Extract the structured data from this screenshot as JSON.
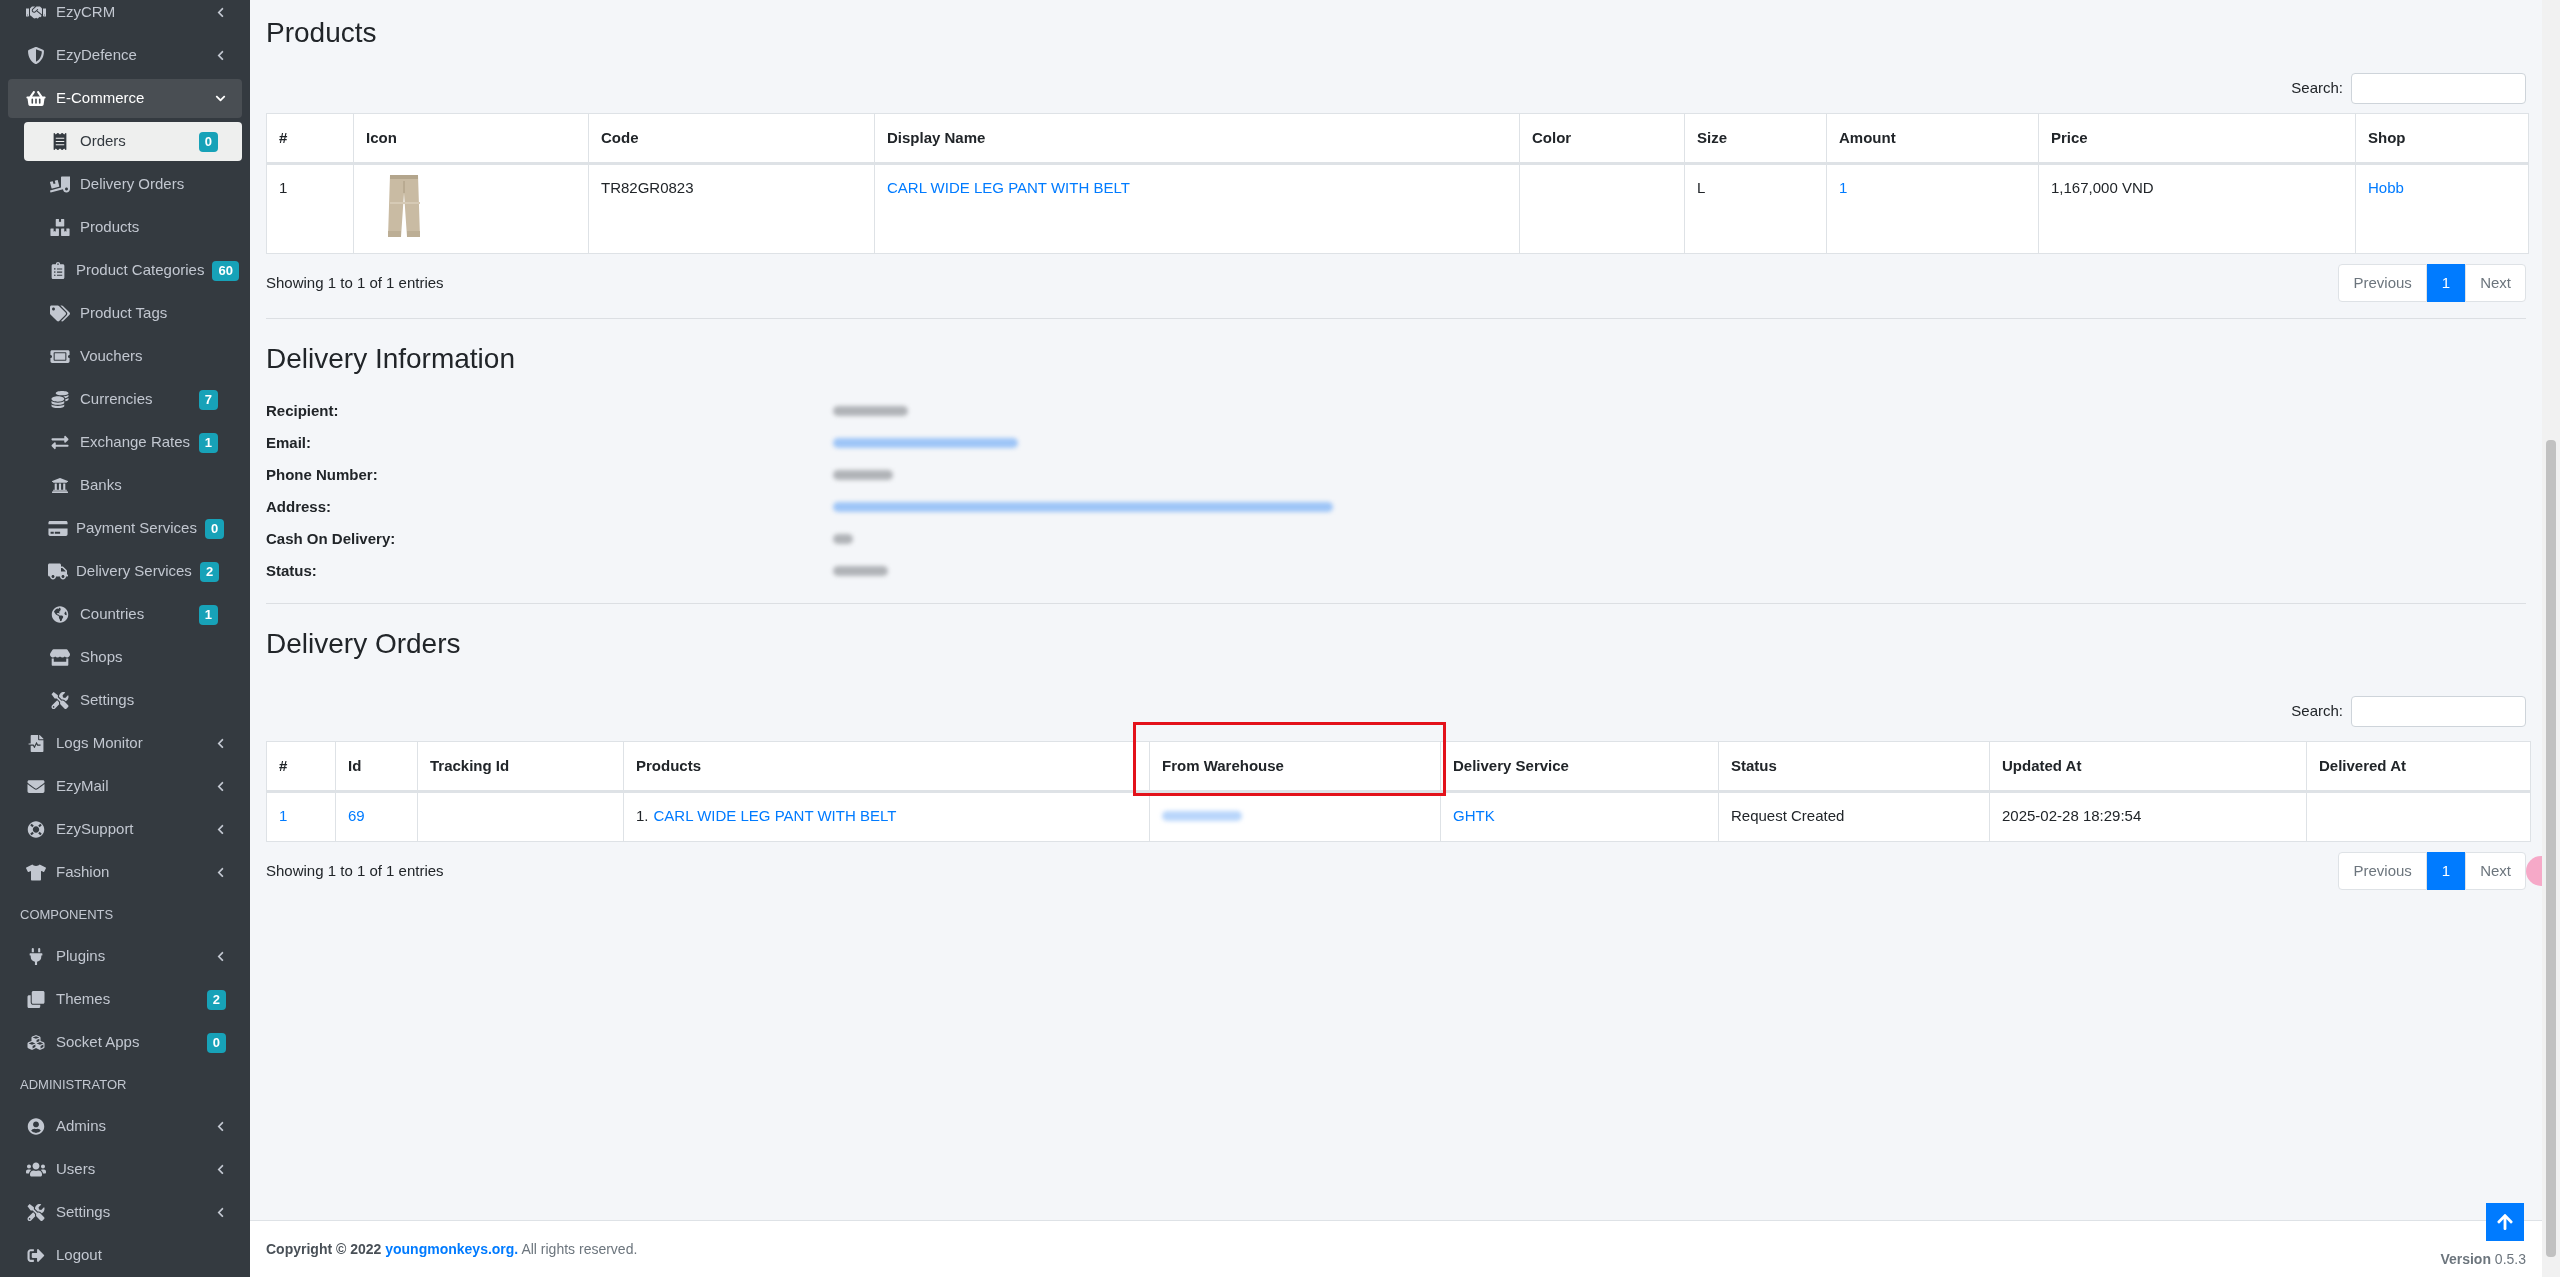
{
  "sidebar": {
    "items": [
      {
        "kind": "item",
        "label": "EzyCRM",
        "selected": false,
        "expanded": false
      },
      {
        "kind": "item",
        "label": "EzyDefence",
        "selected": false,
        "expanded": false
      },
      {
        "kind": "item",
        "label": "E-Commerce",
        "selected": false,
        "expanded": true,
        "children": [
          {
            "label": "Orders",
            "selected": true,
            "badge": "0"
          },
          {
            "label": "Delivery Orders",
            "selected": false
          },
          {
            "label": "Products",
            "selected": false
          },
          {
            "label": "Product Categories",
            "selected": false,
            "badge": "60"
          },
          {
            "label": "Product Tags",
            "selected": false
          },
          {
            "label": "Vouchers",
            "selected": false
          },
          {
            "label": "Currencies",
            "selected": false,
            "badge": "7"
          },
          {
            "label": "Exchange Rates",
            "selected": false,
            "badge": "1"
          },
          {
            "label": "Banks",
            "selected": false
          },
          {
            "label": "Payment Services",
            "selected": false,
            "badge": "0"
          },
          {
            "label": "Delivery Services",
            "selected": false,
            "badge": "2"
          },
          {
            "label": "Countries",
            "selected": false,
            "badge": "1"
          },
          {
            "label": "Shops",
            "selected": false
          },
          {
            "label": "Settings",
            "selected": false
          }
        ]
      },
      {
        "kind": "item",
        "label": "Logs Monitor",
        "selected": false,
        "expanded": false
      },
      {
        "kind": "item",
        "label": "EzyMail",
        "selected": false,
        "expanded": false
      },
      {
        "kind": "item",
        "label": "EzySupport",
        "selected": false,
        "expanded": false
      },
      {
        "kind": "item",
        "label": "Fashion",
        "selected": false,
        "expanded": false
      },
      {
        "kind": "header",
        "label": "COMPONENTS"
      },
      {
        "kind": "item",
        "label": "Plugins",
        "selected": false,
        "expanded": false
      },
      {
        "kind": "item",
        "label": "Themes",
        "selected": false,
        "badge": "2"
      },
      {
        "kind": "item",
        "label": "Socket Apps",
        "selected": false,
        "badge": "0"
      },
      {
        "kind": "header",
        "label": "ADMINISTRATOR"
      },
      {
        "kind": "item",
        "label": "Admins",
        "selected": false,
        "expanded": false
      },
      {
        "kind": "item",
        "label": "Users",
        "selected": false,
        "expanded": false
      },
      {
        "kind": "item",
        "label": "Settings",
        "selected": false,
        "expanded": false
      },
      {
        "kind": "item",
        "label": "Logout",
        "selected": false
      }
    ]
  },
  "products": {
    "title": "Products",
    "search_label": "Search:",
    "columns": [
      {
        "label": "#"
      },
      {
        "label": "Icon"
      },
      {
        "label": "Code"
      },
      {
        "label": "Display Name"
      },
      {
        "label": "Color"
      },
      {
        "label": "Size"
      },
      {
        "label": "Amount"
      },
      {
        "label": "Price"
      },
      {
        "label": "Shop"
      }
    ],
    "rows": [
      {
        "cells": [
          {
            "kind": "text",
            "text": "1"
          },
          {
            "kind": "picture"
          },
          {
            "kind": "text",
            "text": "TR82GR0823"
          },
          {
            "kind": "link",
            "text": "CARL WIDE LEG PANT WITH BELT"
          },
          {
            "kind": "empty"
          },
          {
            "kind": "text",
            "text": "L"
          },
          {
            "kind": "link",
            "text": "1"
          },
          {
            "kind": "text",
            "text": "1,167,000 VND"
          },
          {
            "kind": "link",
            "text": "Hobb"
          }
        ]
      }
    ],
    "info": "Showing 1 to 1 of 1 entries",
    "pages": [
      {
        "label": "Previous",
        "selected": false,
        "disabled": true
      },
      {
        "label": "1",
        "selected": true,
        "disabled": false
      },
      {
        "label": "Next",
        "selected": false,
        "disabled": true
      }
    ]
  },
  "delivery_information": {
    "title": "Delivery Information",
    "rows": [
      {
        "label": "Recipient:",
        "blurred": true,
        "link": false
      },
      {
        "label": "Email:",
        "blurred": true,
        "link": true
      },
      {
        "label": "Phone Number:",
        "blurred": true,
        "link": false
      },
      {
        "label": "Address:",
        "blurred": true,
        "link": true
      },
      {
        "label": "Cash On Delivery:",
        "blurred": true,
        "link": false
      },
      {
        "label": "Status:",
        "blurred": true,
        "link": false
      }
    ]
  },
  "delivery_orders": {
    "title": "Delivery Orders",
    "search_label": "Search:",
    "columns": [
      {
        "label": "#"
      },
      {
        "label": "Id"
      },
      {
        "label": "Tracking Id"
      },
      {
        "label": "Products"
      },
      {
        "label": "From Warehouse",
        "highlighted": true
      },
      {
        "label": "Delivery Service"
      },
      {
        "label": "Status"
      },
      {
        "label": "Updated At"
      },
      {
        "label": "Delivered At"
      }
    ],
    "rows": [
      {
        "cells": [
          {
            "kind": "link",
            "text": "1"
          },
          {
            "kind": "link",
            "text": "69"
          },
          {
            "kind": "empty"
          },
          {
            "kind": "numbered_link",
            "number": "1.",
            "text": "CARL WIDE LEG PANT WITH BELT"
          },
          {
            "kind": "redacted_link"
          },
          {
            "kind": "link",
            "text": "GHTK"
          },
          {
            "kind": "text",
            "text": "Request Created"
          },
          {
            "kind": "text",
            "text": "2025-02-28 18:29:54"
          },
          {
            "kind": "empty"
          }
        ]
      }
    ],
    "info": "Showing 1 to 1 of 1 entries",
    "pages": [
      {
        "label": "Previous",
        "selected": false,
        "disabled": true
      },
      {
        "label": "1",
        "selected": true,
        "disabled": false
      },
      {
        "label": "Next",
        "selected": false,
        "disabled": true
      }
    ]
  },
  "footer": {
    "copyright": "Copyright © 2022",
    "link": "youngmonkeys.org.",
    "rights": "All rights reserved.",
    "version": "**Version** 0.5.3"
  }
}
